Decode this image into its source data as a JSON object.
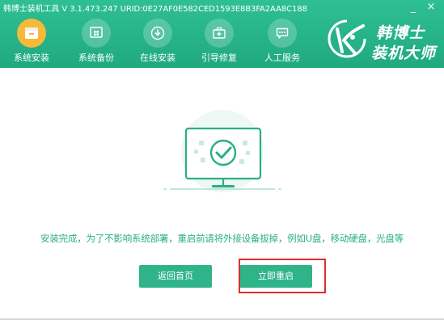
{
  "window": {
    "title": "韩博士装机工具 V 3.1.473.247 URID:0E27AF0E582CED1593E8B3FA2AA8C188",
    "minimize_glyph": "_",
    "close_glyph": "×"
  },
  "nav": {
    "items": [
      {
        "label": "系统安装",
        "icon": "box-icon",
        "active": true
      },
      {
        "label": "系统备份",
        "icon": "windows-icon",
        "active": false
      },
      {
        "label": "在线安装",
        "icon": "download-icon",
        "active": false
      },
      {
        "label": "引导修复",
        "icon": "medkit-icon",
        "active": false
      },
      {
        "label": "人工服务",
        "icon": "chat-icon",
        "active": false
      }
    ]
  },
  "logo": {
    "line1": "韩博士",
    "line2": "装机大师"
  },
  "main": {
    "message": "安装完成，为了不影响系统部署，重启前请将外接设备拔掉，例如U盘，移动硬盘，光盘等",
    "home_button": "返回首页",
    "restart_button": "立即重启"
  },
  "colors": {
    "brand": "#22ac82",
    "active_nav": "#f6b938",
    "highlight": "#e12b2b"
  }
}
